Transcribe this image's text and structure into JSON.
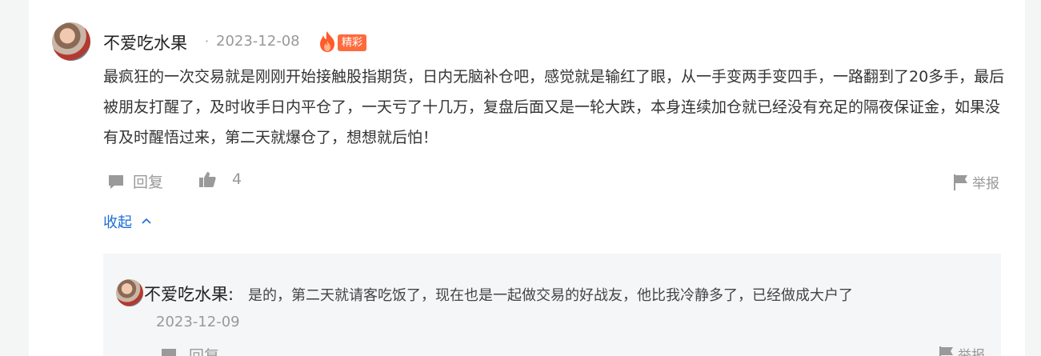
{
  "comment": {
    "author": "不爱吃水果",
    "separator": "·",
    "date": "2023-12-08",
    "badge": "精彩",
    "text": "最疯狂的一次交易就是刚刚开始接触股指期货，日内无脑补仓吧，感觉就是输红了眼，从一手变两手变四手，一路翻到了20多手，最后被朋友打醒了，及时收手日内平仓了，一天亏了十几万，复盘后面又是一轮大跌，本身连续加仓就已经没有充足的隔夜保证金，如果没有及时醒悟过来，第二天就爆仓了，想想就后怕！",
    "reply_label": "回复",
    "like_count": "4",
    "report_label": "举报",
    "collapse_label": "收起"
  },
  "reply": {
    "author": "不爱吃水果:",
    "text": "是的，第二天就请客吃饭了，现在也是一起做交易的好战友，他比我冷静多了，已经做成大户了",
    "date": "2023-12-09",
    "reply_label": "回复",
    "report_label": "举报"
  },
  "colors": {
    "accent_link": "#1a6cd6",
    "badge_bg": "#ff6a3d",
    "muted": "#999999"
  },
  "icons": [
    "comment-icon",
    "thumbs-up-icon",
    "flag-icon",
    "fire-icon",
    "chevron-up-icon"
  ]
}
